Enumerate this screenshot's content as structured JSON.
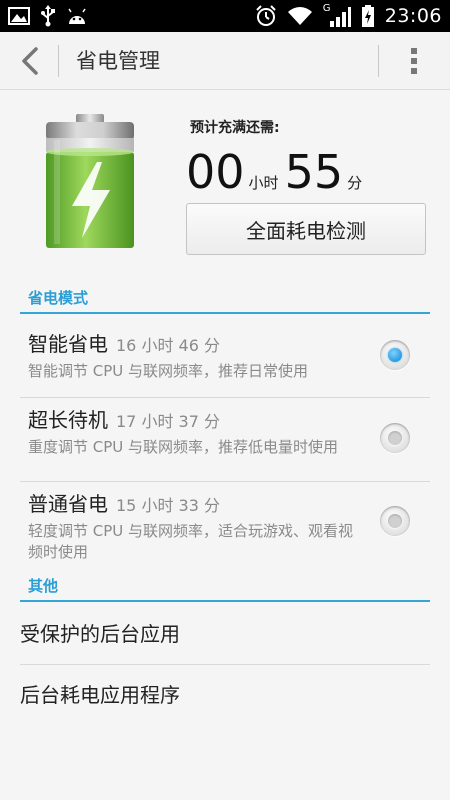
{
  "status_bar": {
    "clock": "23:06",
    "network_type": "G",
    "left_icons": [
      "image-icon",
      "usb-icon",
      "android-icon"
    ],
    "right_icons": [
      "alarm-icon",
      "wifi-icon",
      "signal-icon",
      "battery-charging-icon"
    ]
  },
  "header": {
    "title": "省电管理",
    "back_icon": "chevron-left-icon",
    "menu_icon": "overflow-menu-icon"
  },
  "summary": {
    "estimate_label": "预计充满还需:",
    "hours": "00",
    "hours_unit": "小时",
    "minutes": "55",
    "minutes_unit": "分",
    "detect_button": "全面耗电检测",
    "battery_icon": "battery-charging-large-icon"
  },
  "power_modes": {
    "title": "省电模式",
    "items": [
      {
        "name": "智能省电",
        "duration": "16 小时 46 分",
        "description": "智能调节 CPU 与联网频率，推荐日常使用",
        "selected": true
      },
      {
        "name": "超长待机",
        "duration": "17 小时 37 分",
        "description": "重度调节 CPU 与联网频率，推荐低电量时使用",
        "selected": false
      },
      {
        "name": "普通省电",
        "duration": "15 小时 33 分",
        "description": "轻度调节 CPU 与联网频率，适合玩游戏、观看视频时使用",
        "selected": false
      }
    ]
  },
  "other": {
    "title": "其他",
    "items": [
      "受保护的后台应用",
      "后台耗电应用程序"
    ]
  },
  "colors": {
    "accent": "#33a5d6",
    "battery_green": "#7cc242"
  }
}
